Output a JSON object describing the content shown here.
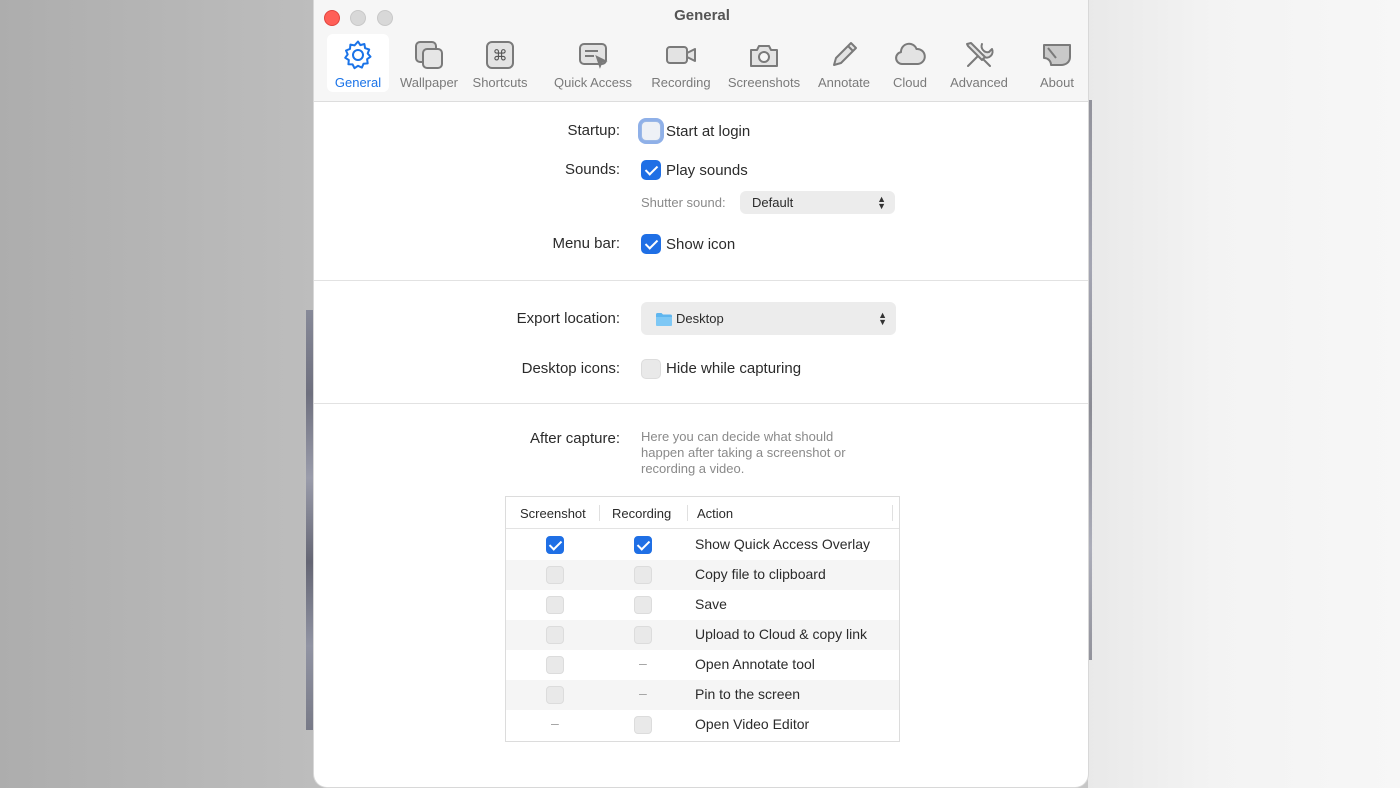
{
  "window": {
    "title": "General"
  },
  "toolbar": {
    "items": [
      {
        "label": "General",
        "icon": "gear-icon",
        "active": true
      },
      {
        "label": "Wallpaper",
        "icon": "wallpaper-icon"
      },
      {
        "label": "Shortcuts",
        "icon": "command-key-icon"
      },
      {
        "label": "Quick Access",
        "icon": "quick-access-icon"
      },
      {
        "label": "Recording",
        "icon": "video-camera-icon"
      },
      {
        "label": "Screenshots",
        "icon": "camera-icon"
      },
      {
        "label": "Annotate",
        "icon": "pencil-icon"
      },
      {
        "label": "Cloud",
        "icon": "cloud-icon"
      },
      {
        "label": "Advanced",
        "icon": "tools-icon"
      },
      {
        "label": "About",
        "icon": "about-icon"
      }
    ]
  },
  "startup": {
    "label": "Startup:",
    "checkbox_label": "Start at login",
    "checked": false
  },
  "sounds": {
    "label": "Sounds:",
    "checkbox_label": "Play sounds",
    "checked": true,
    "shutter_label": "Shutter sound:",
    "shutter_value": "Default"
  },
  "menu_bar": {
    "label": "Menu bar:",
    "checkbox_label": "Show icon",
    "checked": true
  },
  "export": {
    "label": "Export location:",
    "value": "Desktop",
    "icon": "folder-icon"
  },
  "desktop_icons": {
    "label": "Desktop icons:",
    "checkbox_label": "Hide while capturing",
    "checked": false
  },
  "after_capture": {
    "label": "After capture:",
    "description": "Here you can decide what should happen after taking a screenshot or recording a video.",
    "columns": [
      "Screenshot",
      "Recording",
      "Action"
    ],
    "rows": [
      {
        "screenshot": "checked",
        "recording": "checked",
        "action": "Show Quick Access Overlay"
      },
      {
        "screenshot": "unchecked",
        "recording": "unchecked",
        "action": "Copy file to clipboard"
      },
      {
        "screenshot": "unchecked",
        "recording": "unchecked",
        "action": "Save"
      },
      {
        "screenshot": "unchecked",
        "recording": "unchecked",
        "action": "Upload to Cloud & copy link"
      },
      {
        "screenshot": "unchecked",
        "recording": "na",
        "action": "Open Annotate tool"
      },
      {
        "screenshot": "unchecked",
        "recording": "na",
        "action": "Pin to the screen"
      },
      {
        "screenshot": "na",
        "recording": "unchecked",
        "action": "Open Video Editor"
      }
    ],
    "na_symbol": "–"
  },
  "colors": {
    "accent": "#1f6fe5",
    "close": "#ff5f57"
  }
}
